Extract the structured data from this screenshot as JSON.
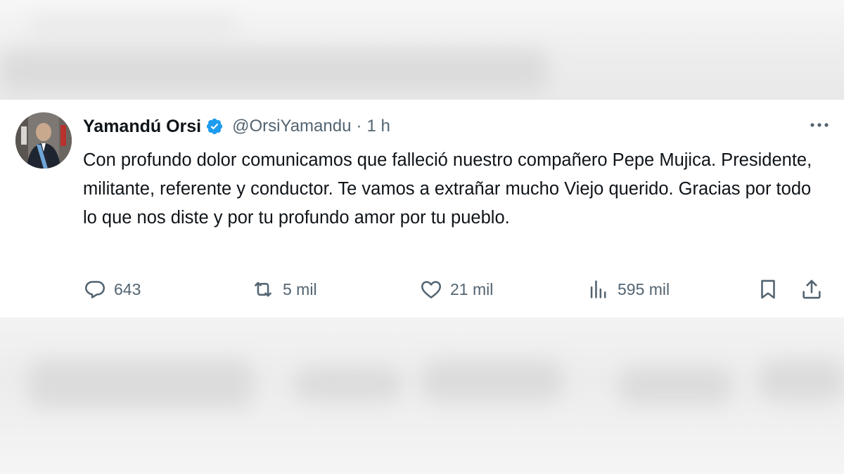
{
  "tweet": {
    "author": {
      "name": "Yamandú Orsi",
      "handle": "@OrsiYamandu",
      "verified": true
    },
    "separator": "·",
    "time": "1 h",
    "text": "Con profundo dolor comunicamos que falleció nuestro compañero Pepe Mujica. Presidente, militante, referente y conductor. Te vamos a extrañar mucho Viejo querido. Gracias por todo lo que nos diste y por tu profundo amor por tu pueblo.",
    "metrics": {
      "replies": "643",
      "reposts": "5 mil",
      "likes": "21 mil",
      "views": "595 mil"
    }
  },
  "colors": {
    "text_primary": "#0f1419",
    "text_secondary": "#536471",
    "verified_blue": "#1d9bf0"
  },
  "icons": [
    "verified-badge-icon",
    "more-icon",
    "reply-icon",
    "repost-icon",
    "like-icon",
    "views-icon",
    "bookmark-icon",
    "share-icon"
  ]
}
